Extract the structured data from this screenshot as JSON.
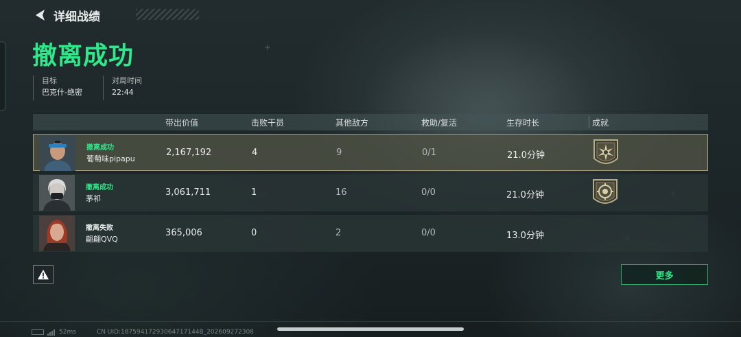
{
  "header": {
    "title": "详细战绩"
  },
  "result": {
    "title": "撤离成功"
  },
  "info": [
    {
      "label": "目标",
      "value": "巴克什-绝密"
    },
    {
      "label": "对局时间",
      "value": "22:44"
    }
  ],
  "table": {
    "headers": {
      "value": "带出价值",
      "kills": "击败干员",
      "enemies": "其他敌方",
      "rescue": "救助/复活",
      "survival": "生存时长",
      "achievement": "成就"
    },
    "rows": [
      {
        "status": "撤离成功",
        "name": "葡萄味pipapu",
        "value": "2,167,192",
        "kills": "4",
        "enemies": "9",
        "rescue": "0/1",
        "survival": "21.0分钟"
      },
      {
        "status": "撤离成功",
        "name": "茅祁",
        "value": "3,061,711",
        "kills": "1",
        "enemies": "16",
        "rescue": "0/0",
        "survival": "21.0分钟"
      },
      {
        "status": "撤离失败",
        "name": "翩翩QVQ",
        "value": "365,006",
        "kills": "0",
        "enemies": "2",
        "rescue": "0/0",
        "survival": "13.0分钟"
      }
    ]
  },
  "buttons": {
    "more": "更多"
  },
  "footer": {
    "ping": "52ms",
    "uid": "CN UID:18759417293064717144B_2026092723​08"
  },
  "colors": {
    "accent": "#2ee88a",
    "selected_border": "#a79d7b"
  }
}
